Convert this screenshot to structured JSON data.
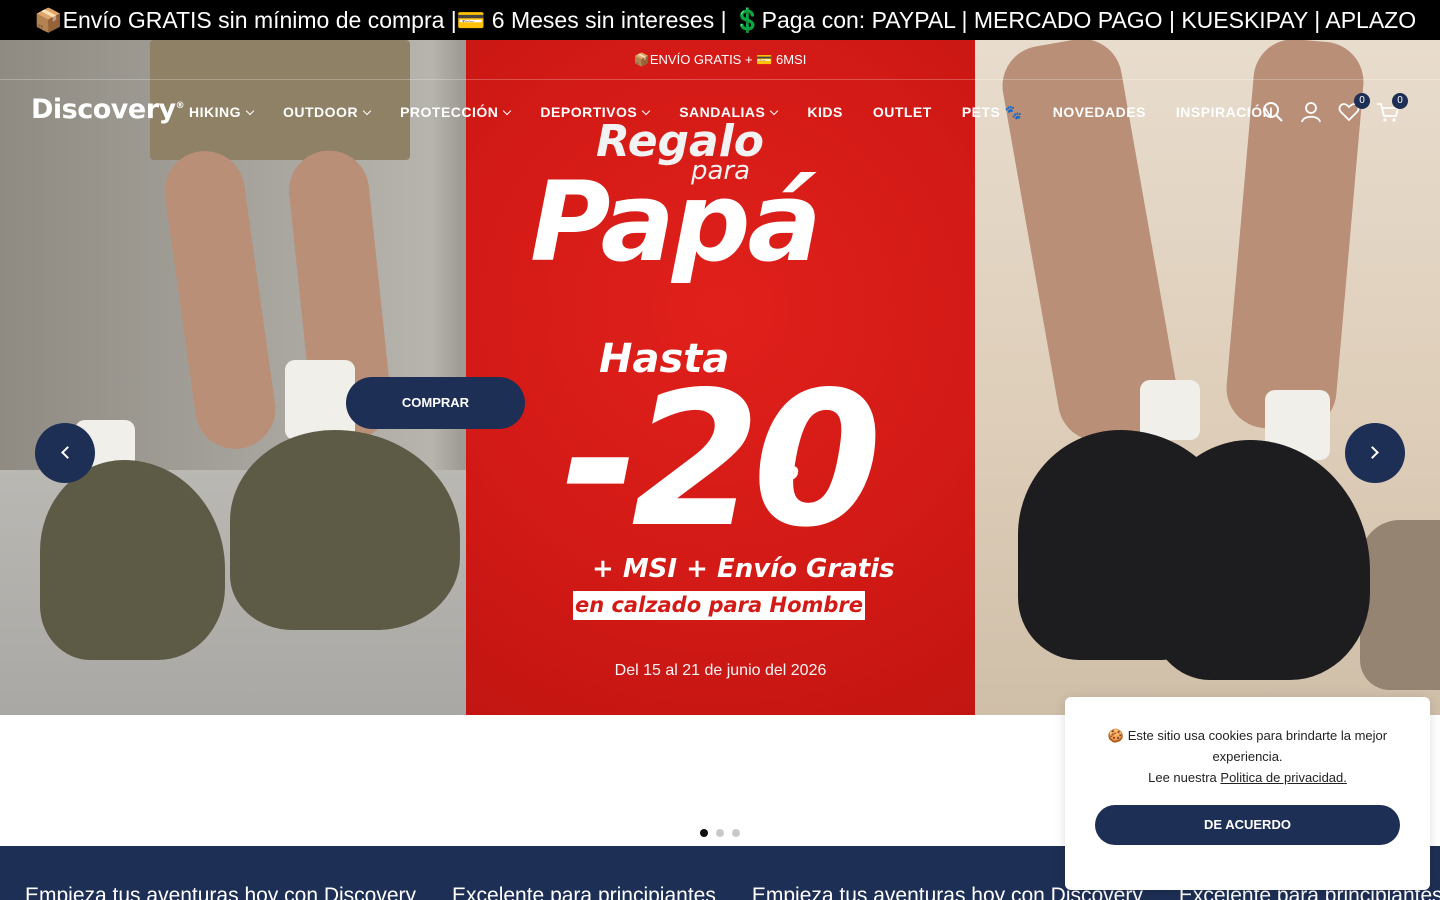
{
  "ticker": {
    "text": "📦Envío GRATIS sin mínimo de compra |💳 6 Meses sin intereses | 💲Paga con: PAYPAL | MERCADO PAGO | KUESKIPAY | APLAZO"
  },
  "announcement": {
    "text": "📦ENVÍO GRATIS + 💳 6MSI"
  },
  "header": {
    "logo": "Discovery",
    "menu": [
      {
        "label": "HIKING",
        "dropdown": true
      },
      {
        "label": "OUTDOOR",
        "dropdown": true
      },
      {
        "label": "PROTECCIÓN",
        "dropdown": true
      },
      {
        "label": "DEPORTIVOS",
        "dropdown": true
      },
      {
        "label": "SANDALIAS",
        "dropdown": true
      },
      {
        "label": "KIDS",
        "dropdown": false
      },
      {
        "label": "OUTLET",
        "dropdown": false
      },
      {
        "label": "PETS 🐾",
        "dropdown": false
      },
      {
        "label": "NOVEDADES",
        "dropdown": false
      },
      {
        "label": "INSPIRACIÓN",
        "dropdown": false
      }
    ],
    "icons": [
      "search-icon",
      "account-icon",
      "wishlist-icon",
      "cart-icon"
    ],
    "wishlist_count": "0",
    "cart_count": "0"
  },
  "hero": {
    "regalo": "Regalo",
    "para": "para",
    "papa": "Papá",
    "hasta": "Hasta",
    "discount": "-20",
    "percent": "%",
    "extras": "+ MSI + Envío Gratis",
    "category": "en calzado para Hombre",
    "dates": "Del 15 al 21 de junio del 2026",
    "cta": "COMPRAR",
    "slide_count": 3,
    "active_slide": 1
  },
  "cookie": {
    "message": "🍪 Este sitio usa cookies para brindarte la mejor experiencia.",
    "policy_prefix": "Lee nuestra ",
    "policy_link": "Politica de privacidad.",
    "accept": "DE ACUERDO"
  },
  "marquee": [
    "Empieza tus aventuras hoy con Discovery",
    "Excelente para principiantes",
    "Empieza tus aventuras hoy con Discovery",
    "Excelente para principiantes"
  ],
  "colors": {
    "brand_navy": "#1e2f55",
    "promo_red": "#d31a16"
  }
}
